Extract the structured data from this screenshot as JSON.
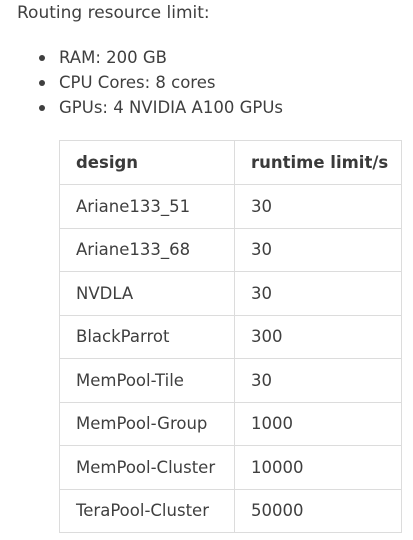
{
  "intro_text": "Routing resource limit:",
  "resources": [
    "RAM: 200 GB",
    "CPU Cores: 8 cores",
    "GPUs: 4 NVIDIA A100 GPUs"
  ],
  "table": {
    "headers": [
      "design",
      "runtime limit/s"
    ],
    "rows": [
      [
        "Ariane133_51",
        "30"
      ],
      [
        "Ariane133_68",
        "30"
      ],
      [
        "NVDLA",
        "30"
      ],
      [
        "BlackParrot",
        "300"
      ],
      [
        "MemPool-Tile",
        "30"
      ],
      [
        "MemPool-Group",
        "1000"
      ],
      [
        "MemPool-Cluster",
        "10000"
      ],
      [
        "TeraPool-Cluster",
        "50000"
      ]
    ]
  }
}
